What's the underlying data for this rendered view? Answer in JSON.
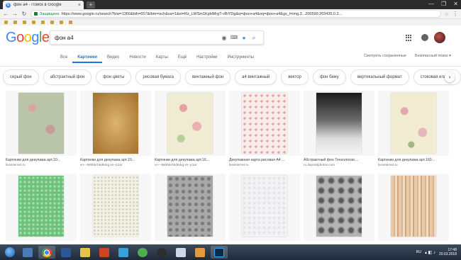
{
  "browser": {
    "tab_title": "фон а4 - Поиск в Google",
    "tab_close": "×",
    "newtab_label": "+",
    "url_secure": "Защищено",
    "url": "https://www.google.ru/search?biw=1360&bih=657&tbm=isch&sa=1&ei=Rz_LWSm1KpHMrgT-vBiYDg&q=фон+а4&oq=фон+а4&gs_l=img.3...200599.203435.0.2...",
    "window_buttons": [
      "—",
      "❐",
      "✕"
    ],
    "bookmarks": [
      "",
      "",
      "",
      "",
      "",
      "",
      "",
      "",
      "",
      ""
    ]
  },
  "google": {
    "logo_letters": [
      "G",
      "o",
      "o",
      "g",
      "l",
      "e"
    ],
    "query": "фон а4",
    "tabs": [
      {
        "label": "Все",
        "active": false
      },
      {
        "label": "Картинки",
        "active": true
      },
      {
        "label": "Видео",
        "active": false
      },
      {
        "label": "Новости",
        "active": false
      },
      {
        "label": "Карты",
        "active": false
      },
      {
        "label": "Ещё",
        "active": false
      },
      {
        "label": "Настройки",
        "active": false
      },
      {
        "label": "Инструменты",
        "active": false
      }
    ],
    "right_links": [
      "Смотреть сохраненные",
      "Безопасный поиск ▾"
    ]
  },
  "chips": [
    "серый фон",
    "абстрактный фон",
    "фон цветы",
    "рисовая бумага",
    "винтажный фон",
    "а4 винтажный",
    "вектор",
    "фон бежу",
    "вертикальный формат",
    "стоковая иллюст"
  ],
  "chip_next": "›",
  "results": [
    {
      "caption": "Картинки для декупажа арт.10...",
      "source": "liveinternet.ru",
      "texture": "t1"
    },
    {
      "caption": "Картинки для декупажа арт.10...",
      "source": "vn---8ebbkchkdkvkg.xn--p1ai",
      "texture": "t2"
    },
    {
      "caption": "Картинки для декупажа арт.16...",
      "source": "vn---8ebbkchkdkvkg.xn--p1ai",
      "texture": "t3"
    },
    {
      "caption": "Декупажная карта рисовая А4 ...",
      "source": "liveinternet.ru",
      "texture": "t4"
    },
    {
      "caption": "Абстрактный фон Технологии ...",
      "source": "ru.depositphotos.com",
      "texture": "t5"
    },
    {
      "caption": "Картинки для декупажа арт.160...",
      "source": "liveinternet.ru",
      "texture": "t6"
    },
    {
      "caption": "",
      "source": "",
      "texture": "t7"
    },
    {
      "caption": "",
      "source": "",
      "texture": "t8"
    },
    {
      "caption": "",
      "source": "",
      "texture": "t9"
    },
    {
      "caption": "",
      "source": "",
      "texture": "t10"
    },
    {
      "caption": "",
      "source": "",
      "texture": "t11"
    },
    {
      "caption": "",
      "source": "",
      "texture": "t12"
    }
  ],
  "taskbar": {
    "language": "RU",
    "time": "17:48",
    "date": "20.03.2018"
  }
}
